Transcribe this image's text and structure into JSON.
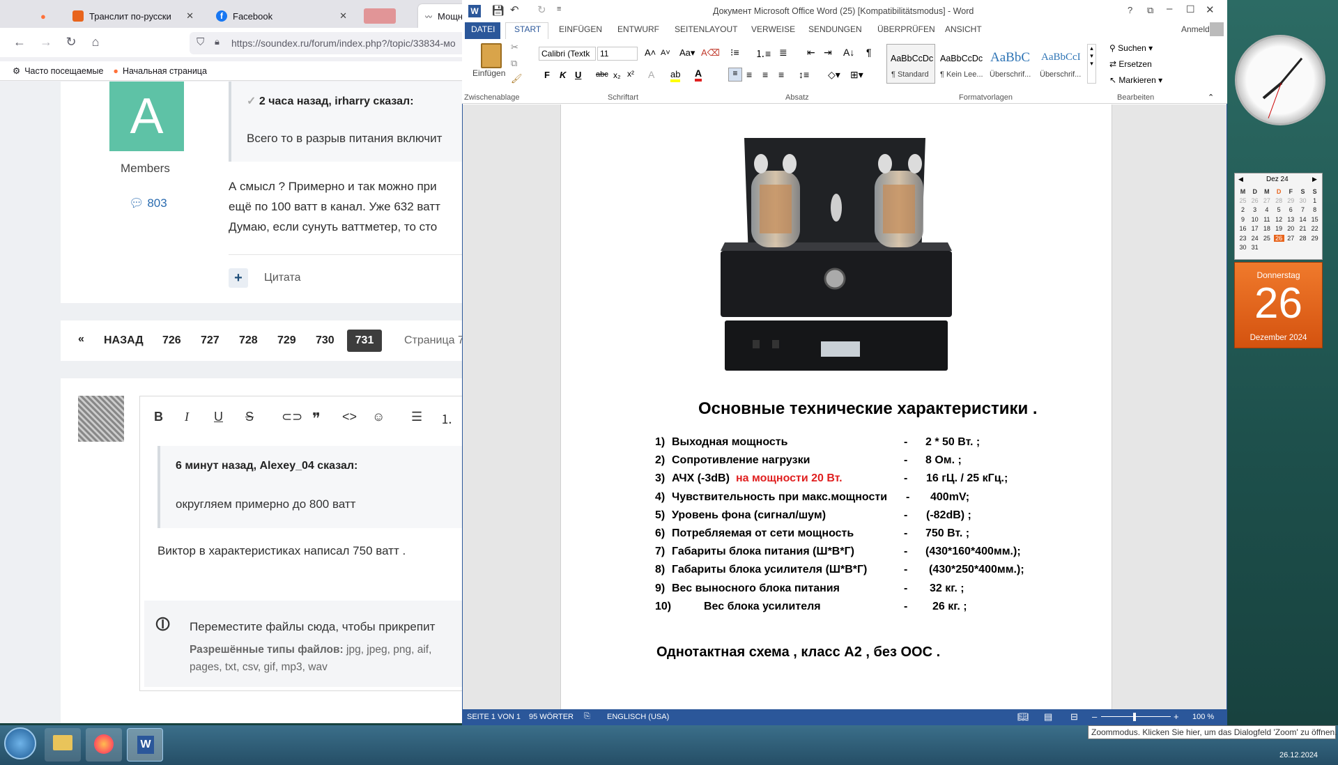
{
  "firefox": {
    "tabs": [
      {
        "label": ""
      },
      {
        "label": "Транслит по-русски"
      },
      {
        "label": "Facebook"
      },
      {
        "label": ""
      },
      {
        "label": "Мощные однотакты - С"
      }
    ],
    "url": "https://soundex.ru/forum/index.php?/topic/33834-мо",
    "bookmarks": [
      "Часто посещаемые",
      "Начальная страница"
    ],
    "forum": {
      "avatar_letter": "A",
      "member_group": "Members",
      "post_count": "803",
      "quote1_author": "2 часа назад, irharry сказал:",
      "quote1_text": "Всего то в разрыв питания включит",
      "post_lines": [
        "А смысл ? Примерно и так можно при",
        "ещё по 100 ватт в канал. Уже 632 ватт",
        "Думаю, если сунуть ваттметер, то сто"
      ],
      "quote_button": "Цитата",
      "pagination": {
        "prev": "НАЗАД",
        "pages": [
          "726",
          "727",
          "728",
          "729",
          "730",
          "731"
        ],
        "current": "731",
        "page_label": "Страница 7"
      },
      "reply": {
        "quote_author": "6 минут назад, Alexey_04 сказал:",
        "quote_text": "округляем примерно до 800 ватт",
        "text": "Виктор в характеристиках написал 750 ватт .",
        "attach_title": "Переместите файлы сюда, чтобы прикрепит",
        "attach_types_label": "Разрешённые типы файлов:",
        "attach_types": " jpg, jpeg, png, aif,",
        "attach_types2": "pages, txt, csv, gif, mp3, wav"
      }
    }
  },
  "word": {
    "title": "Документ Microsoft Office Word (25) [Kompatibilitätsmodus] - Word",
    "signin": "Anmelden",
    "tabs": [
      "DATEI",
      "START",
      "EINFÜGEN",
      "ENTWURF",
      "SEITENLAYOUT",
      "VERWEISE",
      "SENDUNGEN",
      "ÜBERPRÜFEN",
      "ANSICHT"
    ],
    "ribbon": {
      "paste": "Einfügen",
      "font": "Calibri (Textk",
      "size": "11",
      "styles": [
        {
          "preview": "AaBbCcDc",
          "name": "¶ Standard"
        },
        {
          "preview": "AaBbCcDc",
          "name": "¶ Kein Lee..."
        },
        {
          "preview": "AaBbC",
          "name": "Überschrif..."
        },
        {
          "preview": "AaBbCcI",
          "name": "Überschrif..."
        }
      ],
      "edit": [
        "Suchen",
        "Ersetzen",
        "Markieren"
      ],
      "groups": [
        "Zwischenablage",
        "Schriftart",
        "Absatz",
        "Formatvorlagen",
        "Bearbeiten"
      ]
    },
    "doc": {
      "heading": "Основные технические характеристики .",
      "specs": [
        {
          "n": "1)",
          "label": "Выходная мощность",
          "red": "",
          "value": "2 * 50 Вт. ;"
        },
        {
          "n": "2)",
          "label": "Сопротивление нагрузки",
          "red": "",
          "value": "8 Ом. ;"
        },
        {
          "n": "3)",
          "label": "АЧХ (-3dB)",
          "red": "на мощности 20 Вт.",
          "value": "16 гЦ. / 25 кГц.;"
        },
        {
          "n": "4)",
          "label": "Чувствительность при макс.мощности",
          "red": "",
          "value": "400mV;"
        },
        {
          "n": "5)",
          "label": "Уровень фона (сигнал/шум)",
          "red": "",
          "value": "(-82dB) ;"
        },
        {
          "n": "6)",
          "label": "Потребляемая от сети мощность",
          "red": "",
          "value": "750 Вт. ;"
        },
        {
          "n": "7)",
          "label": "Габариты блока питания      (Ш*В*Г)",
          "red": "",
          "value": "(430*160*400мм.);"
        },
        {
          "n": "8)",
          "label": "Габариты блока усилителя  (Ш*В*Г)",
          "red": "",
          "value": "(430*250*400мм.);"
        },
        {
          "n": "9)",
          "label": "Вес  выносного  блока  питания",
          "red": "",
          "value": "32 кг. ;"
        },
        {
          "n": "10)",
          "label": "Вес блока усилителя",
          "red": "",
          "value": "26 кг. ;"
        }
      ],
      "dash": "-",
      "footer_text": "Однотактная схема , класс А2 , без ООС ."
    },
    "status": {
      "page": "SEITE 1 VON 1",
      "words": "95 WÖRTER",
      "lang": "ENGLISCH (USA)",
      "zoom": "100 %"
    }
  },
  "gadgets": {
    "calendar": {
      "month": "Dez 24",
      "weekdays": [
        "M",
        "D",
        "M",
        "D",
        "F",
        "S",
        "S"
      ],
      "weeks": [
        [
          "25",
          "26",
          "27",
          "28",
          "29",
          "30",
          "1"
        ],
        [
          "2",
          "3",
          "4",
          "5",
          "6",
          "7",
          "8"
        ],
        [
          "9",
          "10",
          "11",
          "12",
          "13",
          "14",
          "15"
        ],
        [
          "16",
          "17",
          "18",
          "19",
          "20",
          "21",
          "22"
        ],
        [
          "23",
          "24",
          "25",
          "26",
          "27",
          "28",
          "29"
        ],
        [
          "30",
          "31",
          "",
          "",
          "",
          "",
          ""
        ]
      ],
      "day_name": "Donnerstag",
      "day": "26",
      "month_year": "Dezember 2024"
    }
  },
  "taskbar": {
    "date": "26.12.2024"
  },
  "tooltip": "Zoommodus. Klicken Sie hier, um das Dialogfeld 'Zoom' zu öffnen.",
  "colors": {
    "word_blue": "#2b579a",
    "accent_red": "#e02020",
    "avatar_green": "#5ec2a6",
    "calendar_orange": "#e8641c"
  }
}
